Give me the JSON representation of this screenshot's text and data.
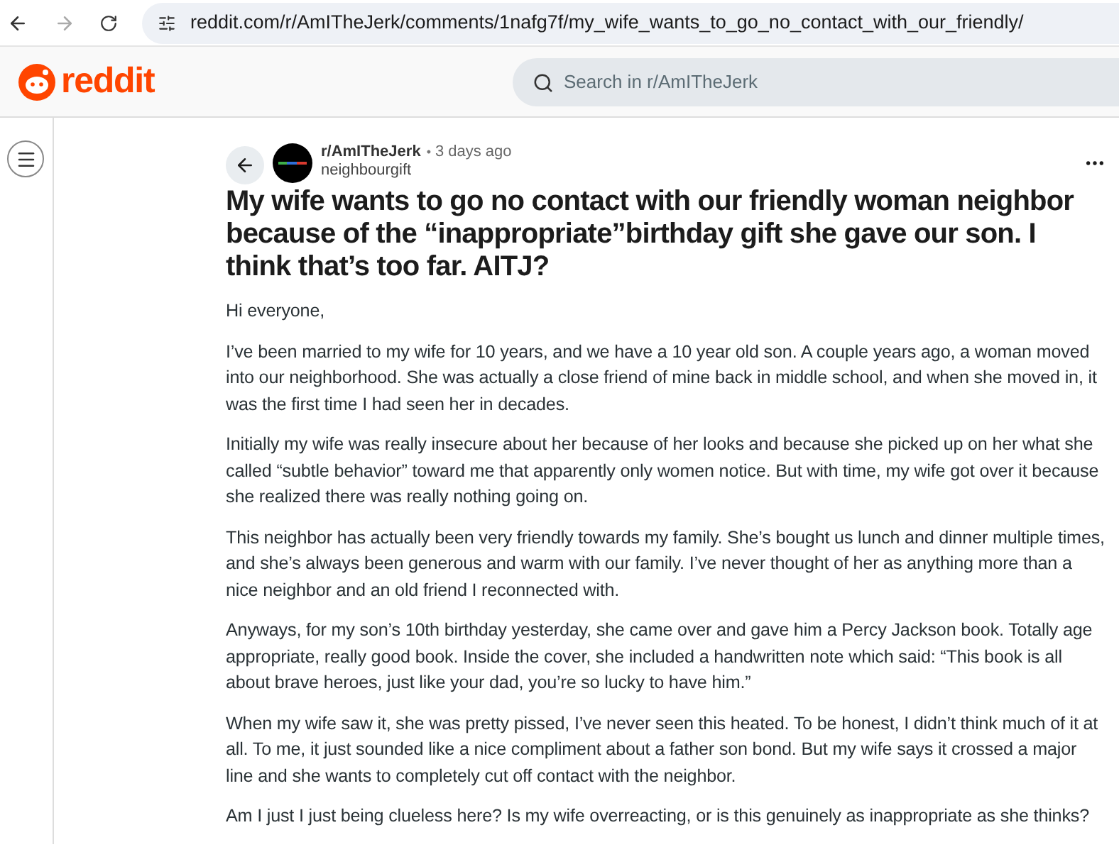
{
  "browser": {
    "url": "reddit.com/r/AmITheJerk/comments/1nafg7f/my_wife_wants_to_go_no_contact_with_our_friendly/"
  },
  "header": {
    "logo_text": "reddit",
    "search": {
      "placeholder": "Search in r/AmITheJerk"
    }
  },
  "post": {
    "subreddit": "r/AmITheJerk",
    "separator": "•",
    "time": "3 days ago",
    "author": "neighbourgift",
    "title": "My wife wants to go no contact with our friendly woman neighbor because of the “inappropriate”birthday gift she gave our son. I think that’s too far. AITJ?",
    "paragraphs": [
      "Hi everyone,",
      "I’ve been married to my wife for 10 years, and we have a 10 year old son. A couple years ago, a woman moved into our neighborhood. She was actually a close friend of mine back in middle school, and when she moved in, it was the first time I had seen her in decades.",
      "Initially my wife was really insecure about her because of her looks and because she picked up on her what she called “subtle behavior” toward me that apparently only women notice. But with time, my wife got over it because she realized there was really nothing going on.",
      "This neighbor has actually been very friendly towards my family. She’s bought us lunch and dinner multiple times, and she’s always been generous and warm with our family. I’ve never thought of her as anything more than a nice neighbor and an old friend I reconnected with.",
      "Anyways, for my son’s 10th birthday yesterday, she came over and gave him a Percy Jackson book. Totally age appropriate, really good book. Inside the cover, she included a handwritten note which said: “This book is all about brave heroes, just like your dad, you’re so lucky to have him.”",
      "When my wife saw it, she was pretty pissed, I’ve never seen this heated. To be honest, I didn’t think much of it at all. To me, it just sounded like a nice compliment about a father son bond. But my wife says it crossed a major line and she wants to completely cut off contact with the neighbor.",
      "Am I just I just being clueless here? Is my wife overreacting, or is this genuinely as inappropriate as she thinks?"
    ]
  }
}
